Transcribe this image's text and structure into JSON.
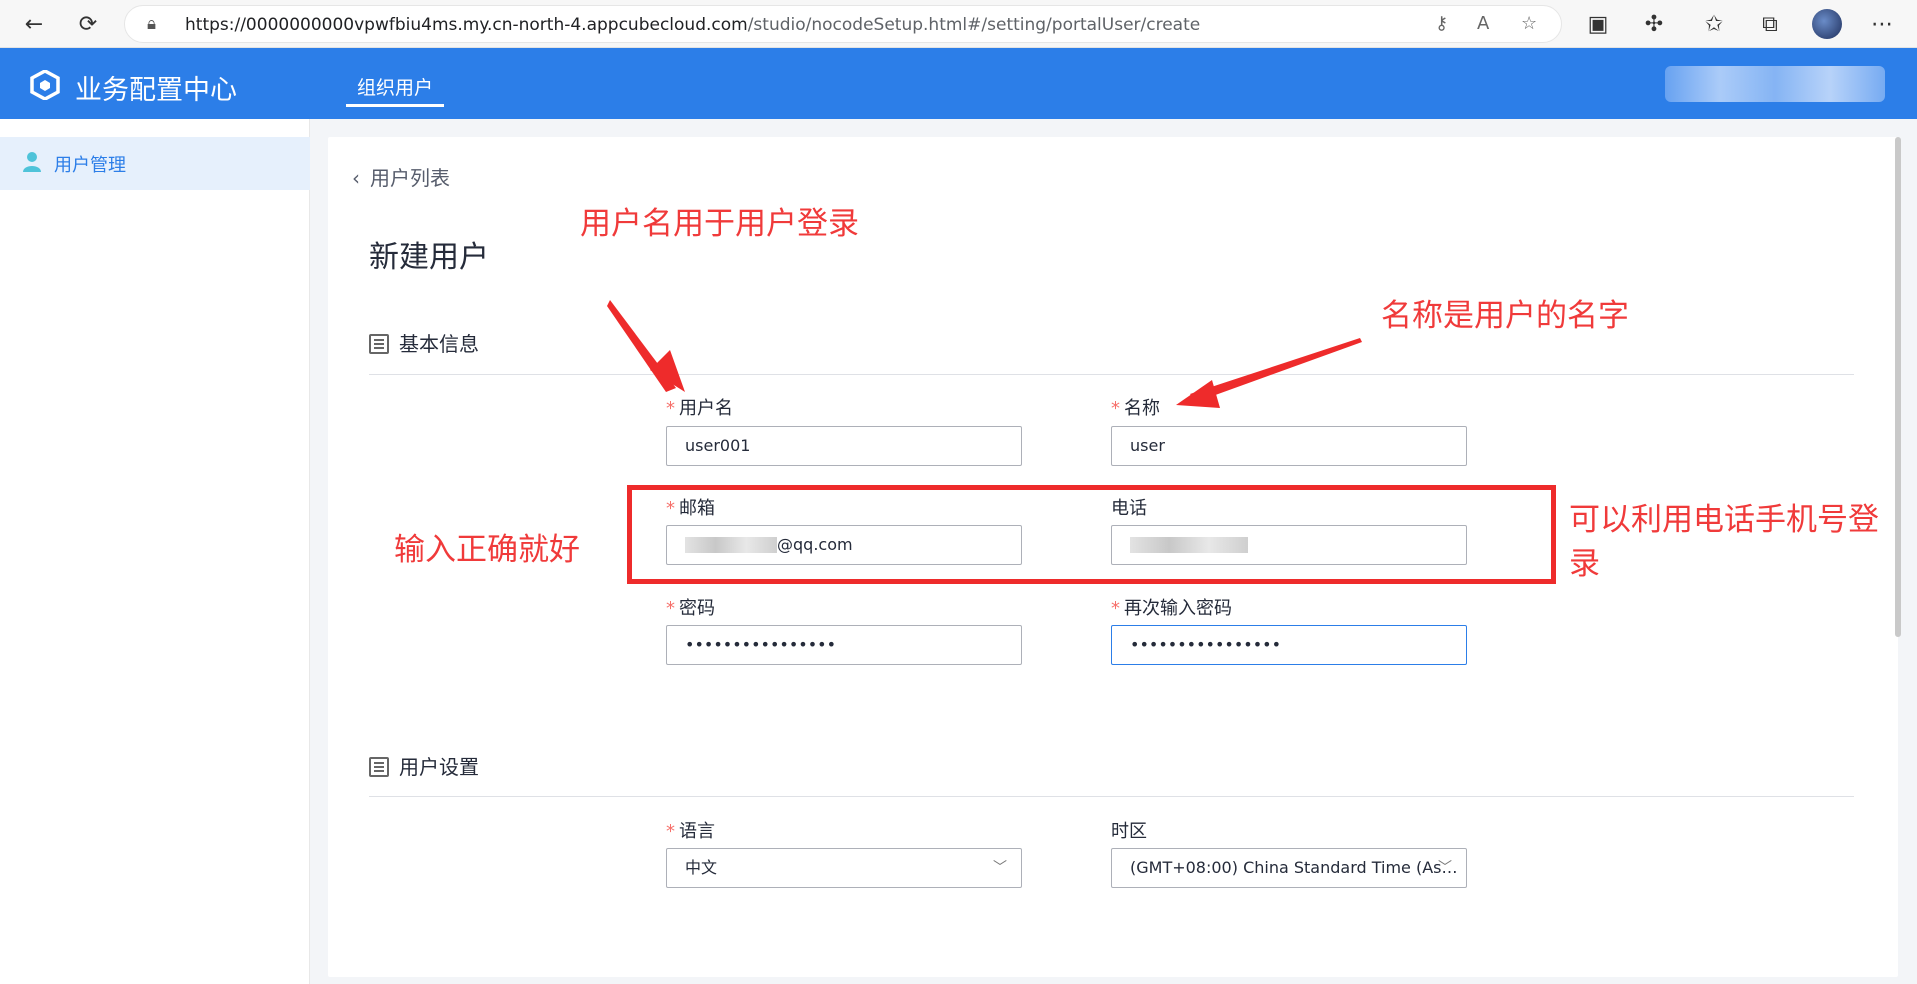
{
  "browser": {
    "url_prefix": "https://0000000000vpwfbiu4ms.my.cn-north-4.appcubecloud.com",
    "url_path": "/studio/nocodeSetup.html#/setting/portalUser/create"
  },
  "header": {
    "app_title": "业务配置中心",
    "nav_tab": "组织用户"
  },
  "sidebar": {
    "items": [
      {
        "label": "用户管理"
      }
    ]
  },
  "main": {
    "back_label": "用户列表",
    "page_title": "新建用户",
    "sections": [
      {
        "title": "基本信息",
        "fields": {
          "username": {
            "label": "用户名",
            "value": "user001",
            "required": true
          },
          "name": {
            "label": "名称",
            "value": "user",
            "required": true
          },
          "email": {
            "label": "邮箱",
            "value_suffix": "@qq.com",
            "required": true
          },
          "phone": {
            "label": "电话",
            "required": false
          },
          "password": {
            "label": "密码",
            "value": "••••••••••••••••",
            "required": true
          },
          "password_confirm": {
            "label": "再次输入密码",
            "value": "••••••••••••••••",
            "required": true
          }
        }
      },
      {
        "title": "用户设置",
        "fields": {
          "language": {
            "label": "语言",
            "value": "中文",
            "required": true
          },
          "timezone": {
            "label": "时区",
            "value": "(GMT+08:00) China Standard Time (As…",
            "required": false
          }
        }
      }
    ]
  },
  "annotations": {
    "username_note": "用户名用于用户登录",
    "name_note": "名称是用户的名字",
    "email_note": "输入正确就好",
    "phone_note_line1": "可以利用电话手机号登",
    "phone_note_line2": "录"
  },
  "colors": {
    "brand": "#2c7ee8",
    "annotation": "#ee2b2b",
    "required_mark": "#f66f6a"
  }
}
